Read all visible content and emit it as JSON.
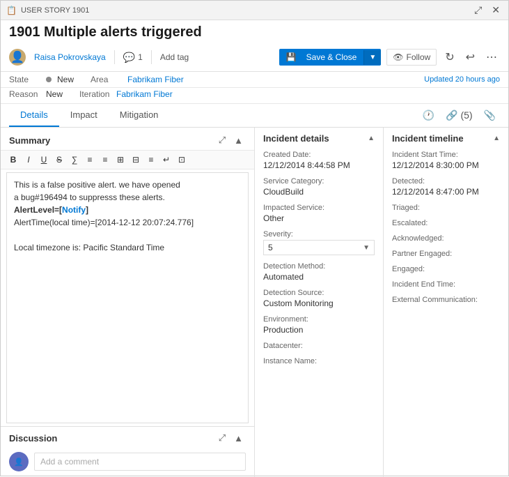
{
  "titleBar": {
    "label": "USER STORY  1901",
    "maximizeTitle": "maximize",
    "closeTitle": "close"
  },
  "mainTitle": "1901  Multiple alerts triggered",
  "toolbar": {
    "userName": "Raisa Pokrovskaya",
    "commentCount": "1",
    "addTagLabel": "Add tag",
    "saveCloseLabel": "Save & Close",
    "followLabel": "Follow"
  },
  "metaBar": {
    "stateLabel": "State",
    "stateValue": "New",
    "reasonLabel": "Reason",
    "reasonValue": "New",
    "areaLabel": "Area",
    "areaValue": "Fabrikam Fiber",
    "iterationLabel": "Iteration",
    "iterationValue": "Fabrikam Fiber",
    "updatedText": "Updated",
    "updatedTime": "20 hours ago"
  },
  "tabs": {
    "details": "Details",
    "impact": "Impact",
    "mitigation": "Mitigation",
    "linkCount": "(5)"
  },
  "summary": {
    "sectionTitle": "Summary",
    "editorButtons": [
      "B",
      "I",
      "U",
      "S",
      "∑",
      "≡",
      "≡",
      "⊞",
      "⊟",
      "≡",
      "↵",
      "⊡"
    ],
    "content": [
      "This is a false positive alert. we have opened",
      "a bug#196494 to suppresss these alerts.",
      "AlertLevel=[Notify]",
      "AlertTime(local time)=[2014-12-12 20:07:24.776]",
      "",
      "Local timezone is: Pacific Standard Time"
    ],
    "notifyText": "Notify"
  },
  "discussion": {
    "sectionTitle": "Discussion",
    "inputPlaceholder": "Add a comment"
  },
  "incidentDetails": {
    "panelTitle": "Incident details",
    "createdDateLabel": "Created Date:",
    "createdDateValue": "12/12/2014 8:44:58 PM",
    "serviceCategoryLabel": "Service Category:",
    "serviceCategoryValue": "CloudBuild",
    "impactedServiceLabel": "Impacted Service:",
    "impactedServiceValue": "Other",
    "severityLabel": "Severity:",
    "severityValue": "5",
    "detectionMethodLabel": "Detection Method:",
    "detectionMethodValue": "Automated",
    "detectionSourceLabel": "Detection Source:",
    "detectionSourceValue": "Custom Monitoring",
    "environmentLabel": "Environment:",
    "environmentValue": "Production",
    "datacenterLabel": "Datacenter:",
    "datacenterValue": "",
    "instanceNameLabel": "Instance Name:",
    "instanceNameValue": ""
  },
  "incidentTimeline": {
    "panelTitle": "Incident timeline",
    "startTimeLabel": "Incident Start Time:",
    "startTimeValue": "12/12/2014 8:30:00 PM",
    "detectedLabel": "Detected:",
    "detectedValue": "12/12/2014 8:47:00 PM",
    "triagedLabel": "Triaged:",
    "triagedValue": "",
    "escalatedLabel": "Escalated:",
    "escalatedValue": "",
    "acknowledgedLabel": "Acknowledged:",
    "acknowledgedValue": "",
    "partnerEngagedLabel": "Partner Engaged:",
    "partnerEngagedValue": "",
    "engagedLabel": "Engaged:",
    "engagedValue": "",
    "endTimeLabel": "Incident End Time:",
    "endTimeValue": "",
    "externalCommLabel": "External Communication:",
    "externalCommValue": ""
  }
}
